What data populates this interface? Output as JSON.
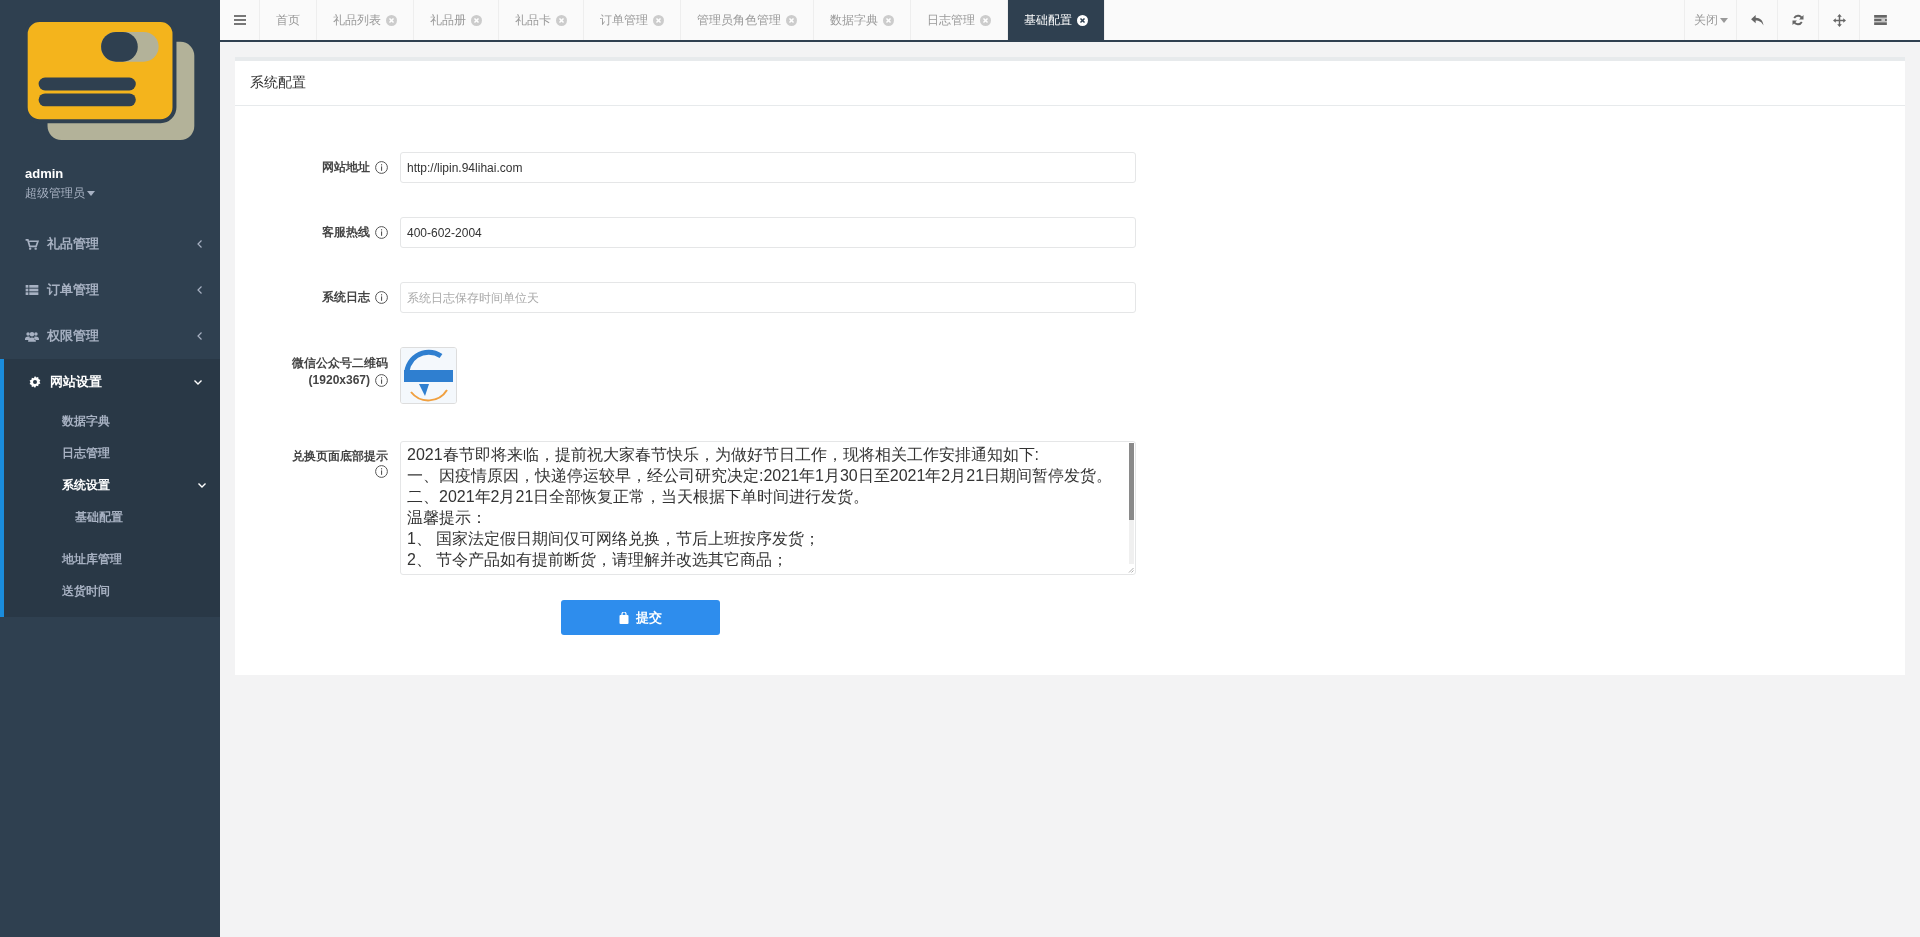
{
  "sidebar": {
    "user": {
      "name": "admin",
      "role": "超级管理员"
    },
    "menu": [
      {
        "label": "礼品管理",
        "expanded": false
      },
      {
        "label": "订单管理",
        "expanded": false
      },
      {
        "label": "权限管理",
        "expanded": false
      },
      {
        "label": "网站设置",
        "expanded": true,
        "children": [
          {
            "label": "数据字典"
          },
          {
            "label": "日志管理"
          },
          {
            "label": "系统设置",
            "expanded": true,
            "children": [
              {
                "label": "基础配置"
              }
            ]
          },
          {
            "label": "地址库管理"
          },
          {
            "label": "送货时间"
          }
        ]
      }
    ]
  },
  "tabs": [
    {
      "label": "首页",
      "closable": false,
      "selected": false
    },
    {
      "label": "礼品列表",
      "closable": true,
      "selected": false
    },
    {
      "label": "礼品册",
      "closable": true,
      "selected": false
    },
    {
      "label": "礼品卡",
      "closable": true,
      "selected": false
    },
    {
      "label": "订单管理",
      "closable": true,
      "selected": false
    },
    {
      "label": "管理员角色管理",
      "closable": true,
      "selected": false
    },
    {
      "label": "数据字典",
      "closable": true,
      "selected": false
    },
    {
      "label": "日志管理",
      "closable": true,
      "selected": false
    },
    {
      "label": "基础配置",
      "closable": true,
      "selected": true
    }
  ],
  "toolbar": {
    "close_menu": "关闭"
  },
  "panel": {
    "title": "系统配置",
    "fields": [
      {
        "kind": "text",
        "label": "网站地址",
        "value": "http://lipin.94lihai.com"
      },
      {
        "kind": "text",
        "label": "客服热线",
        "value": "400-602-2004"
      },
      {
        "kind": "text",
        "label": "系统日志",
        "placeholder": "系统日志保存时间单位天"
      },
      {
        "kind": "image",
        "label": "微信公众号二维码",
        "hint": "(1920x367)"
      },
      {
        "kind": "textarea",
        "label": "兑换页面底部提示",
        "lines": [
          "2021春节即将来临，提前祝大家春节快乐，为做好节日工作，现将相关工作安排通知如下:",
          "一、因疫情原因，快递停运较早，经公司研究决定:2021年1月30日至2021年2月21日期间暂停发货。",
          "二、2021年2月21日全部恢复正常，当天根据下单时间进行发货。",
          "温馨提示：",
          "1、 国家法定假日期间仅可网络兑换，节后上班按序发货；",
          "2、 节令产品如有提前断货，请理解并改选其它商品；"
        ]
      }
    ],
    "submit": "提交"
  }
}
